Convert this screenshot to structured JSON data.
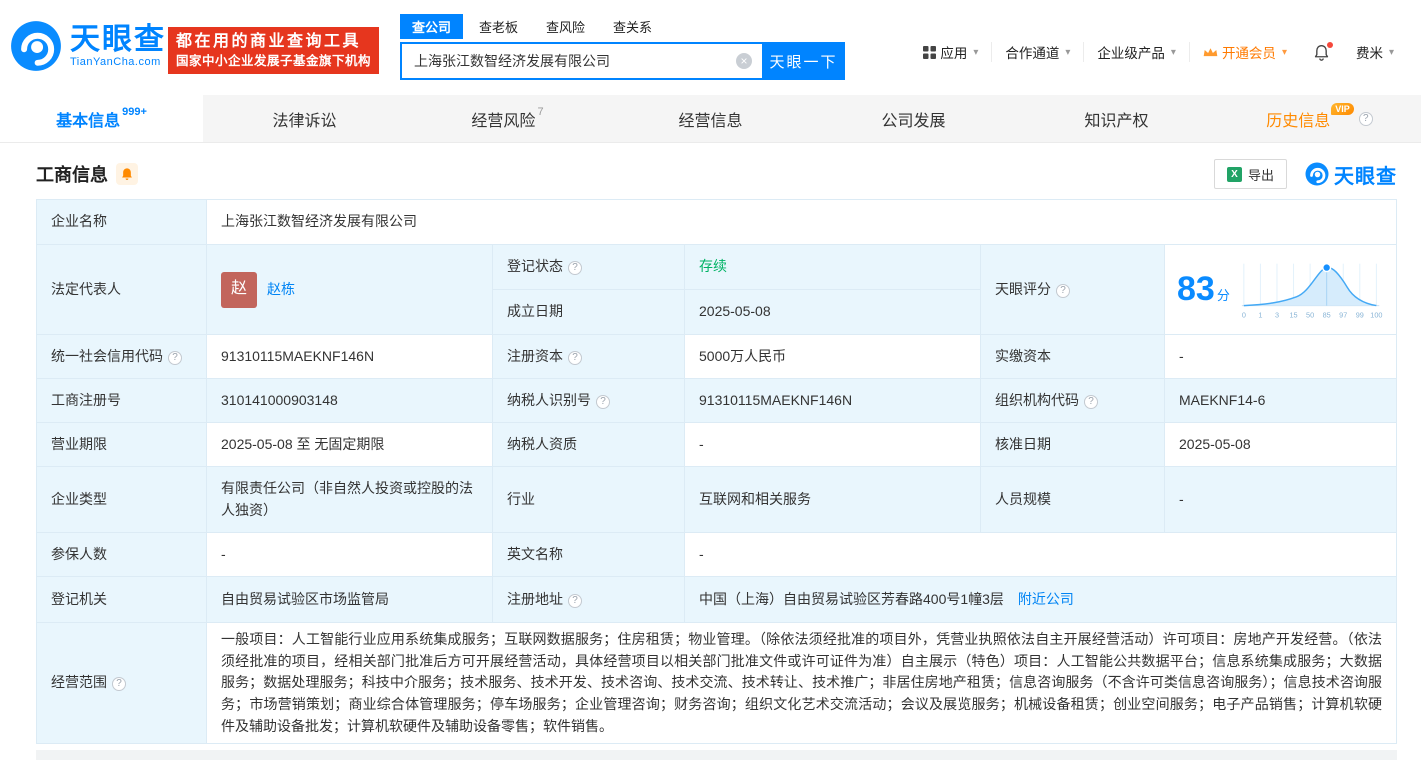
{
  "colors": {
    "brand_blue": "#0084ff",
    "promo_red": "#e6361e",
    "vip_orange": "#ff8a00",
    "status_green": "#00b365",
    "excel_green": "#21a366"
  },
  "icons": {
    "caret": "▾",
    "help": "?",
    "clear": "×",
    "excel": "X"
  },
  "brand": {
    "name": "天眼查",
    "domain": "TianYanCha.com"
  },
  "promo": {
    "line1": "都在用的商业查询工具",
    "line2": "国家中小企业发展子基金旗下机构"
  },
  "search": {
    "tabs": [
      "查公司",
      "查老板",
      "查风险",
      "查关系"
    ],
    "value": "上海张江数智经济发展有限公司",
    "button": "天眼一下"
  },
  "topnav": {
    "apps": "应用",
    "cooperation": "合作通道",
    "enterprise": "企业级产品",
    "vip": "开通会员",
    "user": "费米"
  },
  "tabs": [
    {
      "label": "基本信息",
      "badge": "999+"
    },
    {
      "label": "法律诉讼"
    },
    {
      "label": "经营风险",
      "badge": "7"
    },
    {
      "label": "经营信息"
    },
    {
      "label": "公司发展"
    },
    {
      "label": "知识产权"
    },
    {
      "label": "历史信息",
      "vip": "VIP"
    }
  ],
  "section": {
    "title": "工商信息",
    "export": "导出",
    "watermark": "天眼查"
  },
  "score_axis": [
    "0",
    "1",
    "3",
    "15",
    "50",
    "85",
    "97",
    "99",
    "100"
  ],
  "fields": {
    "name": {
      "label": "企业名称",
      "value": "上海张江数智经济发展有限公司"
    },
    "legal": {
      "label": "法定代表人",
      "value": "赵栋",
      "avatar": "赵"
    },
    "status": {
      "label": "登记状态",
      "value": "存续"
    },
    "established": {
      "label": "成立日期",
      "value": "2025-05-08"
    },
    "score": {
      "label": "天眼评分",
      "value": "83",
      "unit": "分"
    },
    "uscc": {
      "label": "统一社会信用代码",
      "value": "91310115MAEKNF146N"
    },
    "reg_capital": {
      "label": "注册资本",
      "value": "5000万人民币"
    },
    "paid_capital": {
      "label": "实缴资本",
      "value": "-"
    },
    "reg_no": {
      "label": "工商注册号",
      "value": "310141000903148"
    },
    "tax_no": {
      "label": "纳税人识别号",
      "value": "91310115MAEKNF146N"
    },
    "org_code": {
      "label": "组织机构代码",
      "value": "MAEKNF14-6"
    },
    "term": {
      "label": "营业期限",
      "value": "2025-05-08 至 无固定期限"
    },
    "tax_qual": {
      "label": "纳税人资质",
      "value": "-"
    },
    "approval_date": {
      "label": "核准日期",
      "value": "2025-05-08"
    },
    "company_type": {
      "label": "企业类型",
      "value": "有限责任公司（非自然人投资或控股的法人独资）"
    },
    "industry": {
      "label": "行业",
      "value": "互联网和相关服务"
    },
    "staff_size": {
      "label": "人员规模",
      "value": "-"
    },
    "insured_count": {
      "label": "参保人数",
      "value": "-"
    },
    "english_name": {
      "label": "英文名称",
      "value": "-"
    },
    "reg_authority": {
      "label": "登记机关",
      "value": "自由贸易试验区市场监管局"
    },
    "reg_address": {
      "label": "注册地址",
      "value": "中国（上海）自由贸易试验区芳春路400号1幢3层",
      "link": "附近公司"
    },
    "business_scope": {
      "label": "经营范围",
      "value": "一般项目：人工智能行业应用系统集成服务；互联网数据服务；住房租赁；物业管理。（除依法须经批准的项目外，凭营业执照依法自主开展经营活动）许可项目：房地产开发经营。（依法须经批准的项目，经相关部门批准后方可开展经营活动，具体经营项目以相关部门批准文件或许可证件为准）自主展示（特色）项目：人工智能公共数据平台；信息系统集成服务；大数据服务；数据处理服务；科技中介服务；技术服务、技术开发、技术咨询、技术交流、技术转让、技术推广；非居住房地产租赁；信息咨询服务（不含许可类信息咨询服务）；信息技术咨询服务；市场营销策划；商业综合体管理服务；停车场服务；企业管理咨询；财务咨询；组织文化艺术交流活动；会议及展览服务；机械设备租赁；创业空间服务；电子产品销售；计算机软硬件及辅助设备批发；计算机软硬件及辅助设备零售；软件销售。"
    }
  }
}
